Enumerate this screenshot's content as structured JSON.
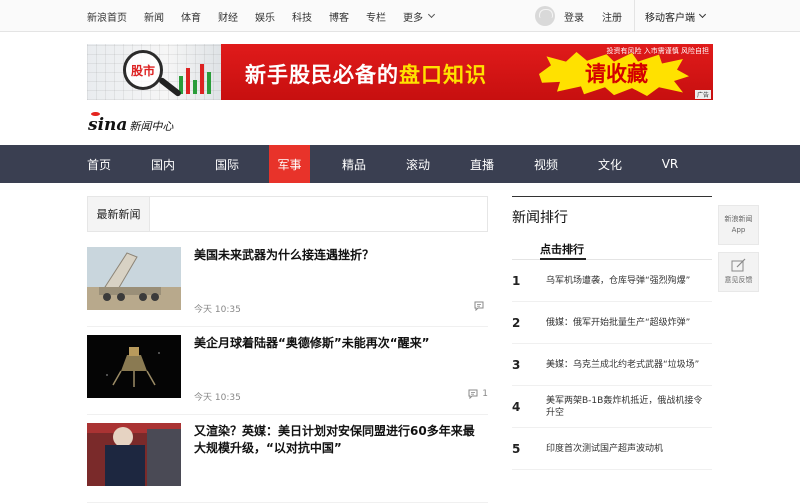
{
  "topbar": {
    "nav": [
      "新浪首页",
      "新闻",
      "体育",
      "财经",
      "娱乐",
      "科技",
      "博客",
      "专栏"
    ],
    "more_label": "更多",
    "login_label": "登录",
    "register_label": "注册",
    "client_label": "移动客户端"
  },
  "banner": {
    "lens_text": "股市",
    "top_line": "投资有风险 入市需谨慎 风险自担",
    "main_prefix": "新手股民必备的",
    "main_highlight": "盘口知识",
    "collect": "请收藏",
    "ad_tag": "广告"
  },
  "brand": {
    "logo_text": "sina",
    "section_title": "新闻中心"
  },
  "main_nav": {
    "items": [
      "首页",
      "国内",
      "国际",
      "军事",
      "精品",
      "滚动",
      "直播",
      "视频",
      "文化",
      "VR"
    ],
    "active": "军事"
  },
  "latest": {
    "header": "最新新闻",
    "items": [
      {
        "headline": "美国未来武器为什么接连遇挫折？",
        "time": "今天 10:35",
        "comments": ""
      },
      {
        "headline": "美企月球着陆器“奥德修斯”未能再次“醒来”",
        "time": "今天 10:35",
        "comments": "1"
      },
      {
        "headline": "又渲染？英媒：美日计划对安保同盟进行60多年来最大规模升级，“以对抗中国”",
        "time": "",
        "comments": ""
      }
    ]
  },
  "ranking": {
    "title": "新闻排行",
    "tab": "点击排行",
    "items": [
      {
        "rank": "1",
        "text": "乌军机场遭袭，仓库导弹“强烈殉爆”"
      },
      {
        "rank": "2",
        "text": "俄媒：俄军开始批量生产“超级炸弹”"
      },
      {
        "rank": "3",
        "text": "美媒：乌克兰成北约老式武器“垃圾场”"
      },
      {
        "rank": "4",
        "text": "美军两架B-1B轰炸机抵近，俄战机接令升空"
      },
      {
        "rank": "5",
        "text": "印度首次测试国产超声波动机"
      }
    ]
  },
  "side": {
    "app_line1": "新浪新闻",
    "app_line2": "App",
    "feedback": "意见反馈"
  },
  "colors": {
    "nav_bg": "#3a3f51",
    "nav_active": "#e8332a",
    "banner_red": "#d41414",
    "banner_yellow": "#ffe100"
  }
}
